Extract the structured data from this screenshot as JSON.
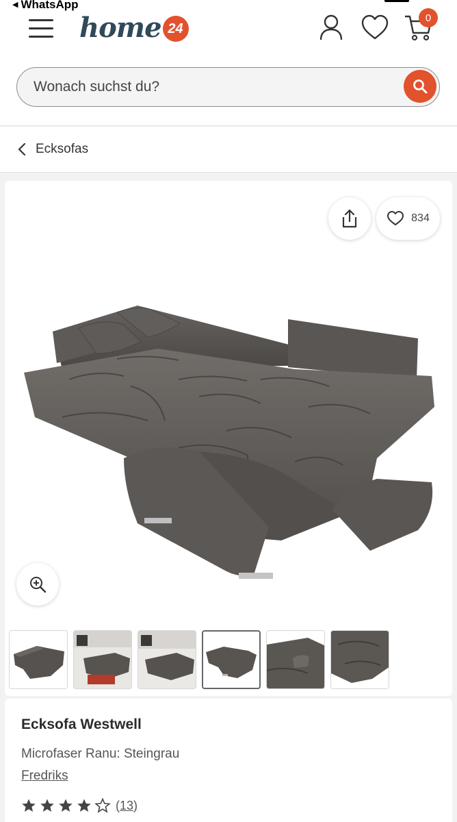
{
  "status_bar": {
    "back_app_label": "WhatsApp"
  },
  "header": {
    "logo_text": "home",
    "logo_badge": "24",
    "cart_count": "0",
    "icons": [
      "menu-icon",
      "user-icon",
      "heart-icon",
      "cart-icon"
    ]
  },
  "search": {
    "placeholder": "Wonach suchst du?"
  },
  "breadcrumb": {
    "label": "Ecksofas"
  },
  "gallery": {
    "favorite_count": "834",
    "thumbnail_count": 6,
    "active_thumbnail": 4
  },
  "product": {
    "title": "Ecksofa Westwell",
    "variant": "Microfaser Ranu: Steingrau",
    "brand": "Fredriks",
    "rating": 4.5,
    "rating_count": "(13)"
  },
  "colors": {
    "accent": "#e2522d",
    "text": "#2b2b2b",
    "sofa": "#5d5a57"
  }
}
